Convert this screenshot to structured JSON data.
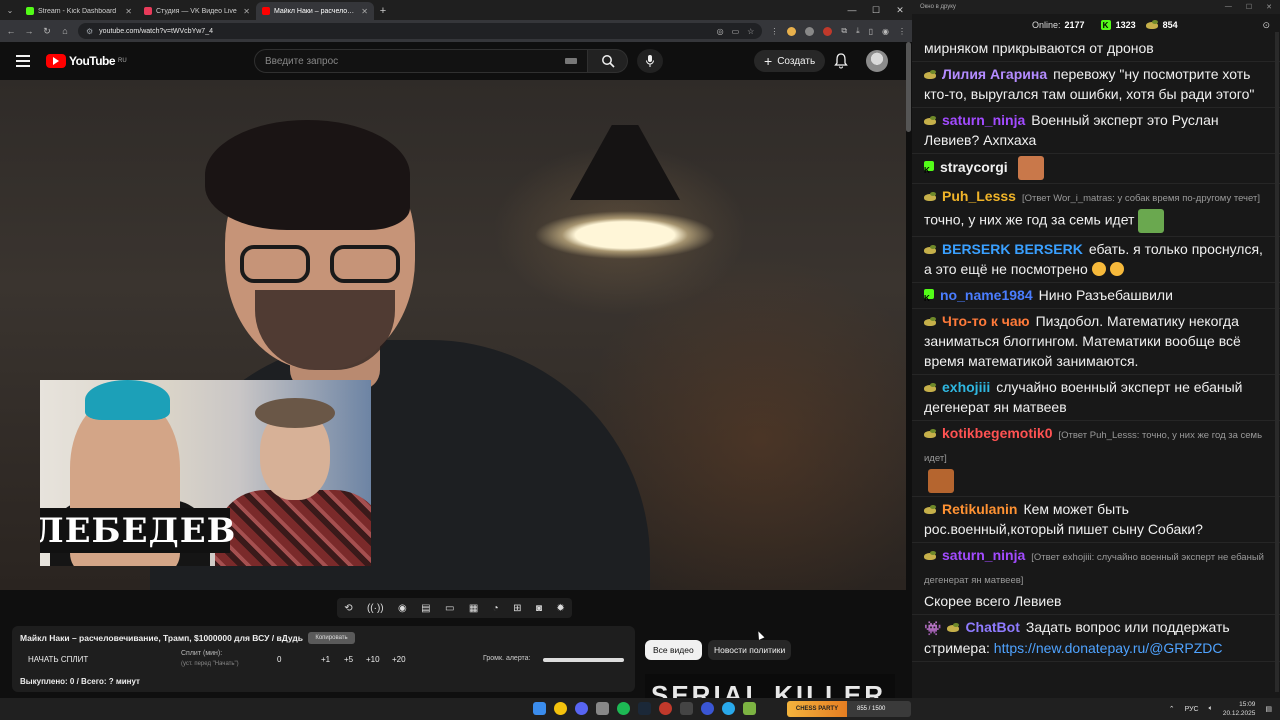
{
  "browser": {
    "tabs": [
      {
        "label": "Stream - Kick Dashboard",
        "color": "#53fc18",
        "active": false
      },
      {
        "label": "Студия — VK Видео Live",
        "color": "#e83b5a",
        "active": false
      },
      {
        "label": "Майкл Наки – расчелове...",
        "color": "#ff0000",
        "active": true
      }
    ],
    "url": "youtube.com/watch?v=tWVcbYw7_4"
  },
  "youtube": {
    "logo_text": "YouTube",
    "region": "RU",
    "search_placeholder": "Введите запрос",
    "create_label": "Создать"
  },
  "video": {
    "pip_title": "ЛЕБЕДЕВ"
  },
  "tool_panel": {
    "title": "Майкл Наки – расчеловечивание, Трамп, $1000000 для ВСУ / вДудь",
    "copy_label": "Копировать",
    "start_split_label": "НАЧАТЬ СПЛИТ",
    "split_label": "Сплит (мин):",
    "split_hint": "(уст. перед \"Начать\")",
    "split_value": "0",
    "increments": [
      "+1",
      "+5",
      "+10",
      "+20"
    ],
    "volume_label": "Громк. алерта:",
    "bought_text": "Выкуплено: 0 / Всего: ? минут"
  },
  "feed": {
    "pill_all": "Все видео",
    "pill_news": "Новости политики",
    "thumb_text": "SERIAL KILLER"
  },
  "chat": {
    "window_title": "Окно в друку",
    "online_label": "Online:",
    "online_count": "2177",
    "kick_count": "1323",
    "vk_count": "854",
    "messages": [
      {
        "src": "none",
        "nick": "",
        "color": "#ffffff",
        "reply": "",
        "text": "мирняком прикрываются от дронов"
      },
      {
        "src": "vk",
        "nick": "Лилия Агарина",
        "color": "#b48cff",
        "reply": "",
        "text": "перевожу \"ну посмотрите хоть кто-то, выругался там ошибки, хотя бы ради этого\""
      },
      {
        "src": "vk",
        "nick": "saturn_ninja",
        "color": "#a24bff",
        "reply": "",
        "text": "Военный эксперт это Руслан Левиев? Ахпхаха"
      },
      {
        "src": "kick",
        "nick": "straycorgi",
        "color": "#f0f0f0",
        "reply": "",
        "text": "",
        "emote": "#c9784a"
      },
      {
        "src": "vk",
        "nick": "Puh_Lesss",
        "color": "#f0b429",
        "reply": "[Ответ Wor_i_matras: у собак время по-другому течет]",
        "text": "точно, у них же год за семь идет",
        "emote": "#6aa84f"
      },
      {
        "src": "vk",
        "nick": "BERSERK BERSERK",
        "color": "#3aa0ff",
        "reply": "",
        "text": "ебать. я только проснулся, а это ещё не посмотрено",
        "emoji": true
      },
      {
        "src": "kick",
        "nick": "no_name1984",
        "color": "#4a7dff",
        "reply": "",
        "text": "Нино Разъебашвили"
      },
      {
        "src": "vk",
        "nick": "Что-то к чаю",
        "color": "#ff7a3a",
        "reply": "",
        "text": "Пиздобол. Математику некогда заниматься блоггингом. Математики вообще всё время математикой занимаются."
      },
      {
        "src": "vk",
        "nick": "exhojiii",
        "color": "#2fb7e0",
        "reply": "",
        "text": "случайно военный эксперт не ебаный дегенерат ян матвеев"
      },
      {
        "src": "vk",
        "nick": "kotikbegemotik0",
        "color": "#ff5252",
        "reply": "[Ответ Puh_Lesss: точно, у них же год за семь идет]",
        "text": "",
        "emote": "#b5652f"
      },
      {
        "src": "vk",
        "nick": "Retikulanin",
        "color": "#ff9233",
        "reply": "",
        "text": "Кем может быть рос.военный,который пишет сыну Собаки?"
      },
      {
        "src": "vk",
        "nick": "saturn_ninja",
        "color": "#a24bff",
        "reply": "[Ответ exhojiii: случайно военный эксперт не ебаный дегенерат ян матвеев]",
        "text": "Скорее всего Левиев"
      },
      {
        "src": "bot",
        "nick": "ChatBot",
        "color": "#8f7bff",
        "reply": "",
        "text": "Задать вопрос или поддержать стримера:",
        "link": "https://new.donatepay.ru/@GRPZDC"
      }
    ]
  },
  "taskbar": {
    "widget_label": "CHESS PARTY",
    "widget_count": "855 / 1500",
    "lang": "РУС",
    "time": "15:09",
    "date": "20.12.2025"
  }
}
